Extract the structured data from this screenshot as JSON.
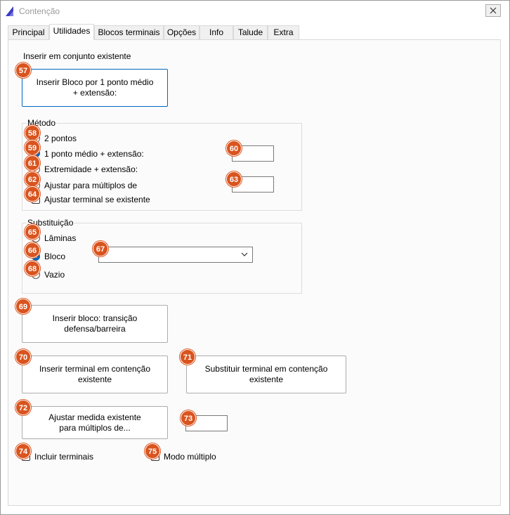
{
  "window": {
    "title": "Contenção",
    "accent_color": "#3a3ac8"
  },
  "tabs": [
    {
      "label": "Principal"
    },
    {
      "label": "Utilidades"
    },
    {
      "label": "Blocos terminais"
    },
    {
      "label": "Opções"
    },
    {
      "label": "Info"
    },
    {
      "label": "Talude"
    },
    {
      "label": "Extra"
    }
  ],
  "insert_existing": {
    "heading": "Inserir em conjunto existente",
    "button_line1": "Inserir Bloco por 1 ponto médio",
    "button_line2": "+ extensão:"
  },
  "metodo": {
    "legend": "Método",
    "opt_2pontos": "2 pontos",
    "opt_ponto_medio": "1 ponto médio + extensão:",
    "opt_extremidade": "Extremidade + extensão:",
    "opt_ajustar_multiplos": "Ajustar para múltiplos de",
    "chk_ajustar_terminal": "Ajustar terminal se existente",
    "extensao_value": "",
    "multiplos_value": ""
  },
  "substituicao": {
    "legend": "Substituição",
    "opt_laminas": "Lâminas",
    "opt_bloco": "Bloco",
    "opt_vazio": "Vazio",
    "bloco_selected": ""
  },
  "actions": {
    "transicao_line1": "Inserir bloco: transição",
    "transicao_line2": "defensa/barreira",
    "inserir_terminal_line1": "Inserir terminal em contenção",
    "inserir_terminal_line2": "existente",
    "substituir_terminal_line1": "Substituir terminal em contenção",
    "substituir_terminal_line2": "existente",
    "ajustar_medida_line1": "Ajustar medida existente",
    "ajustar_medida_line2": "para múltiplos de...",
    "ajustar_medida_value": "",
    "incluir_terminais": "Incluir terminais",
    "modo_multiplo": "Modo múltiplo"
  },
  "badges": {
    "b57": "57",
    "b58": "58",
    "b59": "59",
    "b60": "60",
    "b61": "61",
    "b62": "62",
    "b63": "63",
    "b64": "64",
    "b65": "65",
    "b66": "66",
    "b67": "67",
    "b68": "68",
    "b69": "69",
    "b70": "70",
    "b71": "71",
    "b72": "72",
    "b73": "73",
    "b74": "74",
    "b75": "75"
  },
  "badge_color": "#d9541e"
}
